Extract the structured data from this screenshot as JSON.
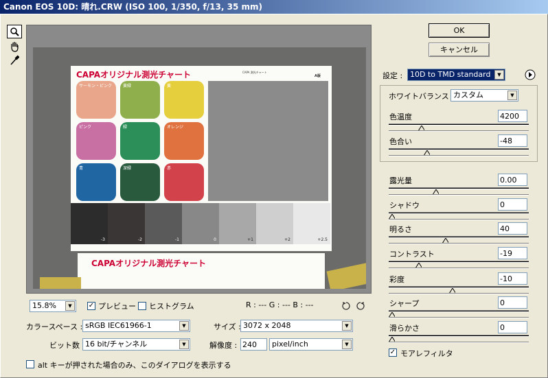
{
  "window": {
    "title": "Canon EOS 10D: 晴れ.CRW (ISO 100, 1/350, f/13, 35 mm)"
  },
  "tools": [
    "zoom-icon",
    "hand-icon",
    "eyedropper-icon"
  ],
  "chart_photo": {
    "title_top": "CAPAオリジナル測光チャート",
    "title_bottom": "CAPAオリジナル測光チャート",
    "fine_print": "CAPA 測光チャート",
    "fine_print_mark": "A版",
    "patches": [
      {
        "label": "サーモン・ピンク",
        "color": "#e9a68a"
      },
      {
        "label": "黄緑",
        "color": "#8fae4c"
      },
      {
        "label": "黄",
        "color": "#e6cf3c"
      },
      {
        "label": "ピンク",
        "color": "#c86fa3"
      },
      {
        "label": "緑",
        "color": "#2c8f5a"
      },
      {
        "label": "オレンジ",
        "color": "#e07240"
      },
      {
        "label": "青",
        "color": "#1f66a3"
      },
      {
        "label": "深緑",
        "color": "#2a5a3e"
      },
      {
        "label": "赤",
        "color": "#d1424a"
      }
    ],
    "gray_steps": [
      {
        "label": "-3",
        "color": "#2c2c2c"
      },
      {
        "label": "-2",
        "color": "#3a3636"
      },
      {
        "label": "-1",
        "color": "#5a5a5a"
      },
      {
        "label": "0",
        "color": "#888888"
      },
      {
        "label": "+1",
        "color": "#a8a8a8"
      },
      {
        "label": "+2",
        "color": "#cfcfcf"
      },
      {
        "label": "+2.5",
        "color": "#e8e8e8"
      }
    ]
  },
  "preview_bar": {
    "zoom": "15.8%",
    "preview_label": "プレビュー",
    "histogram_label": "ヒストグラム",
    "rgb_readout": "R : ---  G : ---  B : ---"
  },
  "workflow": {
    "colorspace_label": "カラースペース :",
    "colorspace_value": "sRGB IEC61966-1",
    "bitdepth_label": "ビット数 :",
    "bitdepth_value": "16 bit/チャンネル",
    "size_label": "サイズ :",
    "size_value": "3072 x 2048",
    "resolution_label": "解像度 :",
    "resolution_value": "240",
    "resolution_unit": "pixel/inch"
  },
  "alt_checkbox_label": "alt キーが押された場合のみ、このダイアログを表示する",
  "buttons": {
    "ok": "OK",
    "cancel": "キャンセル"
  },
  "settings": {
    "label": "設定 :",
    "value": "10D to TMD standard"
  },
  "white_balance": {
    "label": "ホワイトバランス :",
    "value": "カスタム"
  },
  "controls": {
    "color_temp": {
      "label": "色温度",
      "value": "4200",
      "level": 0.22
    },
    "tint": {
      "label": "色合い",
      "value": "-48",
      "level": 0.26
    },
    "exposure": {
      "label": "露光量",
      "value": "0.00",
      "level": 0.33
    },
    "shadow": {
      "label": "シャドウ",
      "value": "0",
      "level": 0.0
    },
    "brightness": {
      "label": "明るさ",
      "value": "40",
      "level": 0.4
    },
    "contrast": {
      "label": "コントラスト",
      "value": "-19",
      "level": 0.2
    },
    "saturation": {
      "label": "彩度",
      "value": "-10",
      "level": 0.45
    },
    "sharpness": {
      "label": "シャープ",
      "value": "0",
      "level": 0.0
    },
    "smoothness": {
      "label": "滑らかさ",
      "value": "0",
      "level": 0.0
    }
  },
  "moire_label": "モアレフィルタ"
}
